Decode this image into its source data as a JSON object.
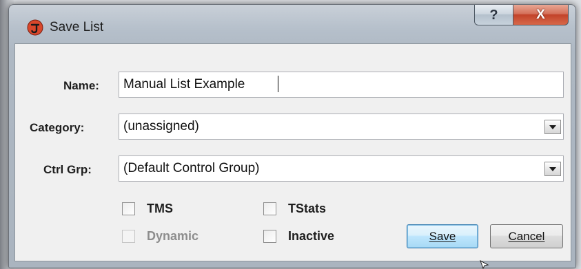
{
  "window": {
    "title": "Save List",
    "help_glyph": "?",
    "close_glyph": "X"
  },
  "form": {
    "name": {
      "label": "Name:",
      "value": "Manual List Example"
    },
    "category": {
      "label": "Category:",
      "value": "(unassigned)"
    },
    "ctrl_grp": {
      "label": "Ctrl Grp:",
      "value": "(Default Control Group)"
    }
  },
  "checkboxes": {
    "tms": {
      "label": "TMS",
      "checked": false,
      "enabled": true
    },
    "tstats": {
      "label": "TStats",
      "checked": false,
      "enabled": true
    },
    "dynamic": {
      "label": "Dynamic",
      "checked": false,
      "enabled": false
    },
    "inactive": {
      "label": "Inactive",
      "checked": false,
      "enabled": true
    }
  },
  "buttons": {
    "save": "Save",
    "cancel": "Cancel"
  },
  "colors": {
    "app_icon": "#d9472b",
    "default_button_border": "#3c7fb1",
    "close_button": "#c2432a"
  },
  "icons": {
    "app": "app-logo-icon",
    "help": "help-icon",
    "close": "close-icon",
    "dropdown": "chevron-down-icon"
  }
}
